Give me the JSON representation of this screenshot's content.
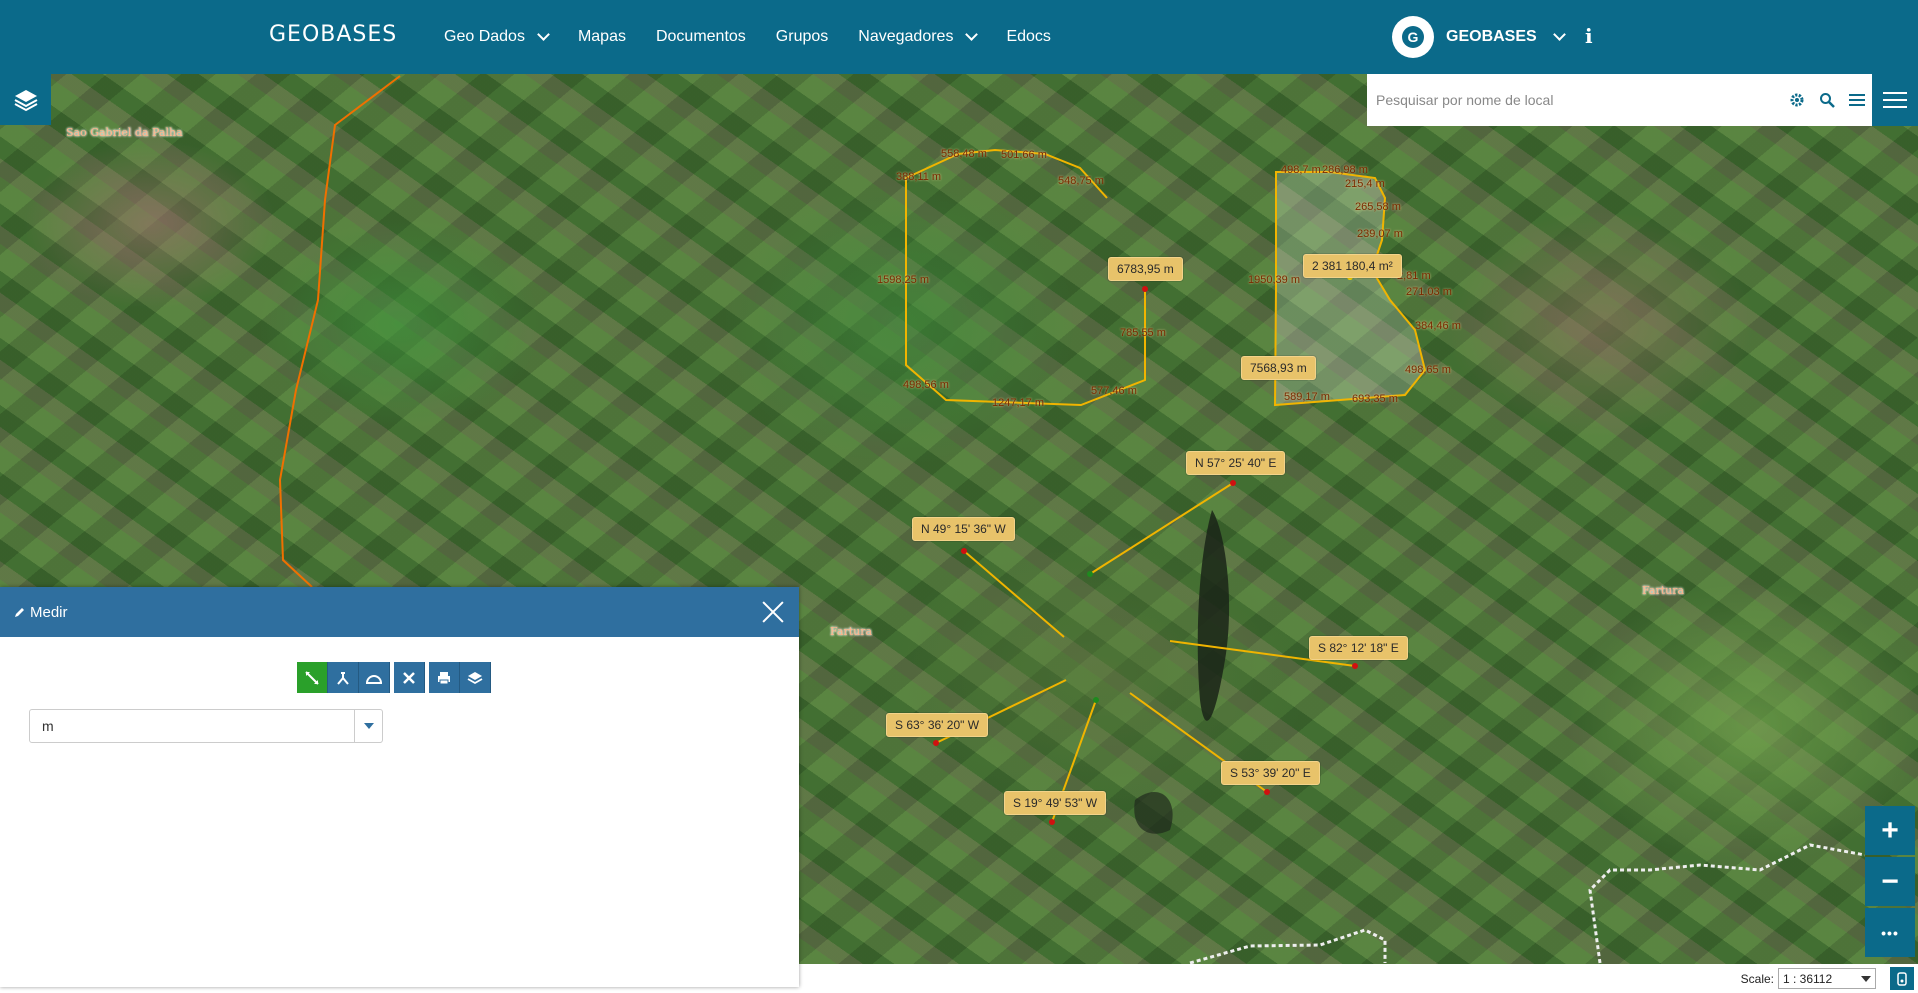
{
  "header": {
    "brand": "GEOBASES",
    "nav": [
      {
        "label": "Geo Dados",
        "has_dropdown": true
      },
      {
        "label": "Mapas",
        "has_dropdown": false
      },
      {
        "label": "Documentos",
        "has_dropdown": false
      },
      {
        "label": "Grupos",
        "has_dropdown": false
      },
      {
        "label": "Navegadores",
        "has_dropdown": true
      },
      {
        "label": "Edocs",
        "has_dropdown": false
      }
    ],
    "user_label": "GEOBASES",
    "info_icon": "i"
  },
  "search": {
    "placeholder": "Pesquisar por nome de local",
    "icons": [
      "gear-icon",
      "search-icon",
      "list-icon"
    ]
  },
  "map": {
    "place_names": [
      "Sao Gabriel da Palha",
      "Fartura",
      "Fartura"
    ],
    "segment_labels": [
      "558,48 m",
      "501,66 m",
      "388,11 m",
      "548,75 m",
      "1598,25 m",
      "785,55 m",
      "498,56 m",
      "1247,17 m",
      "577,46 m",
      "498,7 m",
      "286,98 m",
      "215,4 m",
      "265,58 m",
      "239,07 m",
      "1950,39 m",
      "2,81 m",
      "271,03 m",
      "384,46 m",
      "498,65 m",
      "589,17 m",
      "693,35 m"
    ],
    "total_labels": [
      "6783,95 m",
      "2 381 180,4 m²",
      "7568,93 m"
    ],
    "bearing_labels": [
      "N 57° 25' 40\" E",
      "N 49° 15' 36\" W",
      "S 82° 12' 18\" E",
      "S 63° 36' 20\" W",
      "S 53° 39' 20\" E",
      "S 19° 49' 53\" W"
    ],
    "colors": {
      "measure_line": "#f0b400",
      "boundary": "#f07000",
      "vertex": "#d01010"
    }
  },
  "measure_panel": {
    "title": "Medir",
    "tools": [
      "distance-tool",
      "area-tool",
      "bearing-tool",
      "clear-tool",
      "print-tool",
      "layer-tool"
    ],
    "unit": "m"
  },
  "footer": {
    "scale_label": "Scale:",
    "scale_value": "1 : 36112"
  },
  "zoom": {
    "in": "+",
    "out": "−",
    "more": "•••"
  }
}
